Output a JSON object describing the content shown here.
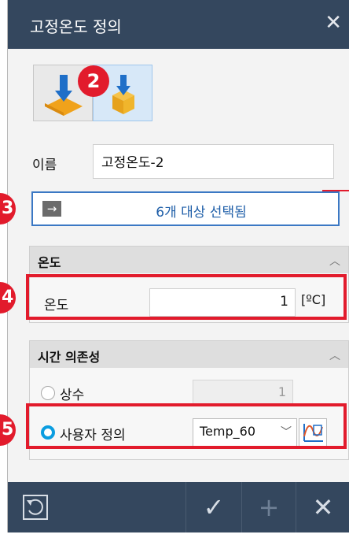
{
  "dialog": {
    "title": "고정온도 정의",
    "close_glyph": "✕"
  },
  "toolbar": {
    "buttons": [
      {
        "icon": "fixed-temperature-surface-icon",
        "selected": false
      },
      {
        "icon": "fixed-temperature-body-icon",
        "selected": true
      }
    ]
  },
  "name": {
    "label": "이름",
    "value": "고정온도-2"
  },
  "selection": {
    "text": "6개 대상 선택됨"
  },
  "temperature_section": {
    "header": "온도",
    "field_label": "온도",
    "value": "1",
    "unit": "[ºC]"
  },
  "time_dependency_section": {
    "header": "시간 의존성",
    "options": [
      {
        "label": "상수",
        "value": "1",
        "checked": false
      },
      {
        "label": "사용자 정의",
        "selected_value": "Temp_60",
        "checked": true
      }
    ]
  },
  "annotations": {
    "badge_2": "2",
    "badge_3": "3",
    "badge_4": "4",
    "badge_5": "5"
  },
  "bottom_bar": {
    "buttons": [
      "reset-icon",
      "ok-check-icon",
      "add-icon",
      "cancel-x-icon"
    ]
  },
  "colors": {
    "titlebar": "#34475e",
    "accent_blue": "#3b78c4",
    "annotation_red": "#e21b2c",
    "radio_selected": "#0b9de0"
  }
}
